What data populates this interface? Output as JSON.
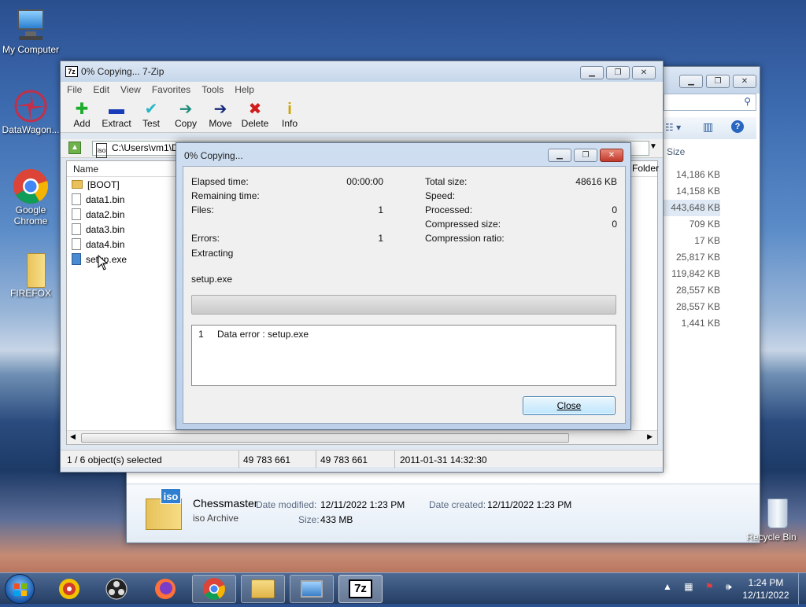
{
  "desktop": {
    "icons": [
      {
        "label": "My Computer",
        "icon": "computer-icon"
      },
      {
        "label": "DataWagon...",
        "icon": "datawagon-icon"
      },
      {
        "label": "Google Chrome",
        "icon": "chrome-icon"
      },
      {
        "label": "FIREFOX",
        "icon": "folder-icon"
      },
      {
        "label": "Recycle Bin",
        "icon": "recycle-bin-icon"
      }
    ]
  },
  "explorer": {
    "size_header": "Size",
    "sizes": [
      "14,186 KB",
      "14,158 KB",
      "443,648 KB",
      "709 KB",
      "17 KB",
      "25,817 KB",
      "119,842 KB",
      "28,557 KB",
      "28,557 KB",
      "1,441 KB"
    ],
    "details": {
      "name": "Chessmaster",
      "type": "iso Archive",
      "modified_label": "Date modified:",
      "modified": "12/11/2022 1:23 PM",
      "created_label": "Date created:",
      "created": "12/11/2022 1:23 PM",
      "size_label": "Size:",
      "size": "433 MB"
    }
  },
  "zip": {
    "title": "0% Copying... 7-Zip",
    "menu": [
      "File",
      "Edit",
      "View",
      "Favorites",
      "Tools",
      "Help"
    ],
    "toolbar": [
      {
        "label": "Add",
        "icon": "plus-icon",
        "glyph": "✚",
        "color": "#1cac2c"
      },
      {
        "label": "Extract",
        "icon": "minus-icon",
        "glyph": "▬",
        "color": "#1a3cb8"
      },
      {
        "label": "Test",
        "icon": "check-icon",
        "glyph": "✔",
        "color": "#27b6c6"
      },
      {
        "label": "Copy",
        "icon": "copy-arrow-icon",
        "glyph": "➔",
        "color": "#1d8a7a"
      },
      {
        "label": "Move",
        "icon": "move-arrow-icon",
        "glyph": "➔",
        "color": "#14287a"
      },
      {
        "label": "Delete",
        "icon": "delete-icon",
        "glyph": "✖",
        "color": "#d11c1c"
      },
      {
        "label": "Info",
        "icon": "info-icon",
        "glyph": "i",
        "color": "#d0a400"
      }
    ],
    "path": "C:\\Users\\vm1\\D",
    "col_name": "Name",
    "col_folder": "Folder",
    "files": [
      {
        "name": "[BOOT]",
        "type": "folder"
      },
      {
        "name": "data1.bin",
        "type": "file"
      },
      {
        "name": "data2.bin",
        "type": "file"
      },
      {
        "name": "data3.bin",
        "type": "file"
      },
      {
        "name": "data4.bin",
        "type": "file"
      },
      {
        "name": "setup.exe",
        "type": "exe"
      }
    ],
    "status": {
      "selected": "1 / 6 object(s) selected",
      "size1": "49 783 661",
      "size2": "49 783 661",
      "date": "2011-01-31 14:32:30"
    }
  },
  "dialog": {
    "title": "0% Copying...",
    "elapsed_label": "Elapsed time:",
    "elapsed": "00:00:00",
    "remaining_label": "Remaining time:",
    "files_label": "Files:",
    "files": "1",
    "errors_label": "Errors:",
    "errors": "1",
    "total_label": "Total size:",
    "total": "48616 KB",
    "speed_label": "Speed:",
    "processed_label": "Processed:",
    "processed": "0",
    "compressed_label": "Compressed size:",
    "compressed": "0",
    "ratio_label": "Compression ratio:",
    "action": "Extracting",
    "current_file": "setup.exe",
    "progress": 0,
    "log_index": "1",
    "log_text": "Data error : setup.exe",
    "close_label": "Close"
  },
  "taskbar": {
    "time": "1:24 PM",
    "date": "12/11/2022"
  }
}
